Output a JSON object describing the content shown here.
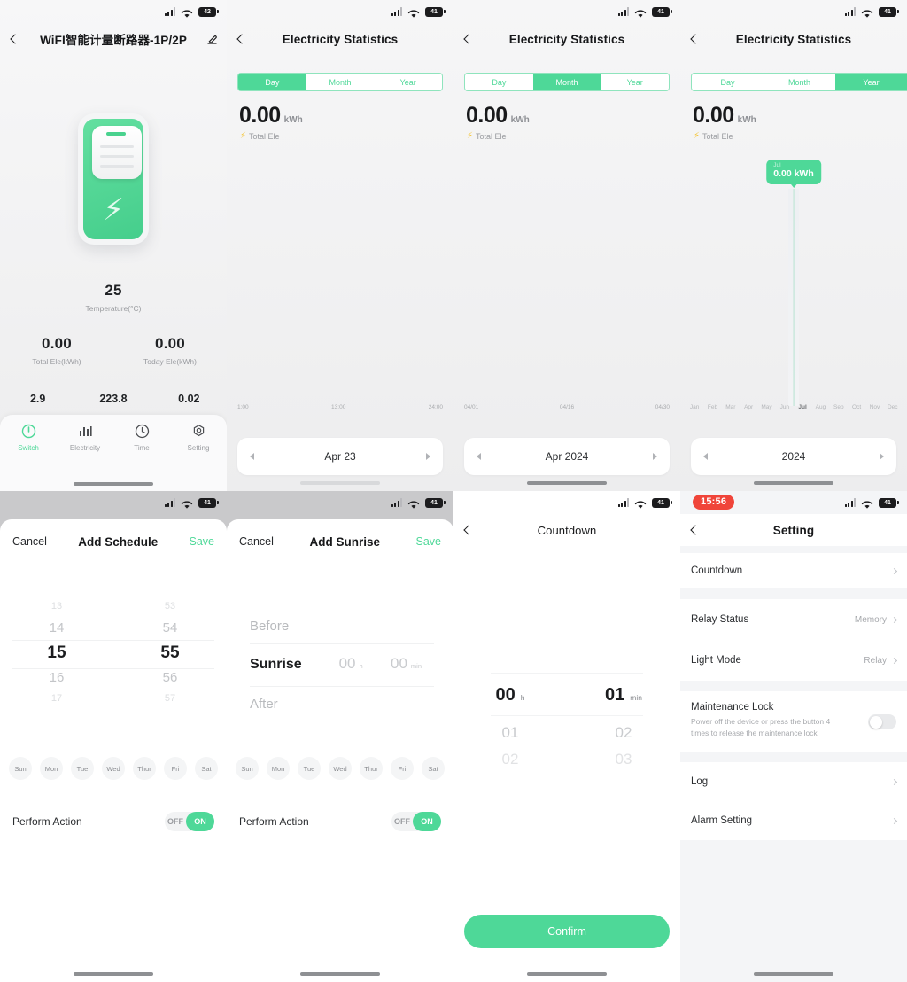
{
  "statusbar": {
    "battery_1": "42",
    "battery_2": "41",
    "rec_time": "15:56"
  },
  "panel_device": {
    "title": "WiFI智能计量断路器-1P/2P",
    "edit_icon": "pencil-icon",
    "temperature": {
      "value": "25",
      "label": "Temperature(°C)"
    },
    "totals": [
      {
        "value": "0.00",
        "label": "Total Ele(kWh)"
      },
      {
        "value": "0.00",
        "label": "Today Ele(kWh)"
      }
    ],
    "raw_values": [
      "2.9",
      "223.8",
      "0.02"
    ],
    "tabs": [
      {
        "label": "Switch",
        "icon": "power-icon",
        "active": true
      },
      {
        "label": "Electricity",
        "icon": "bars-icon",
        "active": false
      },
      {
        "label": "Time",
        "icon": "clock-icon",
        "active": false
      },
      {
        "label": "Setting",
        "icon": "gear-icon",
        "active": false
      }
    ]
  },
  "panel_day": {
    "title": "Electricity Statistics",
    "segments": [
      "Day",
      "Month",
      "Year"
    ],
    "active_segment": "Day",
    "value": "0.00",
    "unit": "kWh",
    "total_label": "Total Ele",
    "date": "Apr 23"
  },
  "panel_month": {
    "title": "Electricity Statistics",
    "segments": [
      "Day",
      "Month",
      "Year"
    ],
    "active_segment": "Month",
    "value": "0.00",
    "unit": "kWh",
    "total_label": "Total Ele",
    "date": "Apr 2024"
  },
  "panel_year": {
    "title": "Electricity Statistics",
    "segments": [
      "Day",
      "Month",
      "Year"
    ],
    "active_segment": "Year",
    "value": "0.00",
    "unit": "kWh",
    "total_label": "Total Ele",
    "date": "2024",
    "tooltip": {
      "period": "Jul",
      "value": "0.00 kWh"
    }
  },
  "panel_schedule": {
    "cancel": "Cancel",
    "title": "Add Schedule",
    "save": "Save",
    "hours": [
      "13",
      "14",
      "15",
      "16",
      "17"
    ],
    "minutes": [
      "53",
      "54",
      "55",
      "56",
      "57"
    ],
    "selected_hour": "15",
    "selected_minute": "55",
    "days": [
      "Sun",
      "Mon",
      "Tue",
      "Wed",
      "Thur",
      "Fri",
      "Sat"
    ],
    "action_label": "Perform Action",
    "action_off": "OFF",
    "action_on": "ON"
  },
  "panel_sunrise": {
    "cancel": "Cancel",
    "title": "Add Sunrise",
    "save": "Save",
    "before": "Before",
    "center": "Sunrise",
    "after": "After",
    "hour": "00",
    "hour_unit": "h",
    "minute": "00",
    "minute_unit": "min",
    "action_label": "Perform Action",
    "action_off": "OFF",
    "action_on": "ON"
  },
  "panel_countdown": {
    "title": "Countdown",
    "hour": "00",
    "hour_unit": "h",
    "minute": "01",
    "minute_unit": "min",
    "hour_next": "01",
    "hour_next2": "02",
    "minute_next": "02",
    "minute_next2": "03",
    "confirm": "Confirm"
  },
  "panel_setting": {
    "title": "Setting",
    "rows": [
      {
        "label": "Countdown",
        "value": ""
      },
      {
        "label": "Relay Status",
        "value": "Memory"
      },
      {
        "label": "Light Mode",
        "value": "Relay"
      }
    ],
    "maintenance": {
      "title": "Maintenance Lock",
      "desc": "Power off the device or press the button 4 times to release the maintenance lock",
      "enabled": false
    },
    "bottom_rows": [
      {
        "label": "Log"
      },
      {
        "label": "Alarm Setting"
      }
    ]
  },
  "chart_data": [
    {
      "type": "bar",
      "title": "Electricity Statistics - Day",
      "xlabel": "",
      "ylabel": "kWh",
      "tick_labels": [
        "1:00",
        "13:00",
        "24:00"
      ],
      "categories": [
        "1:00",
        "13:00",
        "24:00"
      ],
      "values": [
        0,
        0,
        0
      ],
      "total": 0.0,
      "grid": false,
      "legend": false
    },
    {
      "type": "bar",
      "title": "Electricity Statistics - Month",
      "xlabel": "",
      "ylabel": "kWh",
      "tick_labels": [
        "04/01",
        "04/16",
        "04/30"
      ],
      "categories": [
        "04/01",
        "04/16",
        "04/30"
      ],
      "values": [
        0,
        0,
        0
      ],
      "total": 0.0,
      "grid": false,
      "legend": false
    },
    {
      "type": "bar",
      "title": "Electricity Statistics - Year",
      "xlabel": "",
      "ylabel": "kWh",
      "categories": [
        "Jan",
        "Feb",
        "Mar",
        "Apr",
        "May",
        "Jun",
        "Jul",
        "Aug",
        "Sep",
        "Oct",
        "Nov",
        "Dec"
      ],
      "values": [
        0,
        0,
        0,
        0,
        0,
        0,
        0,
        0,
        0,
        0,
        0,
        0
      ],
      "highlighted": "Jul",
      "annotation": "Jul 0.00 kWh",
      "total": 0.0,
      "grid": false,
      "legend": false
    }
  ],
  "colors": {
    "accent": "#4ed898",
    "record": "#f0453a",
    "bolt": "#f5c63a"
  }
}
